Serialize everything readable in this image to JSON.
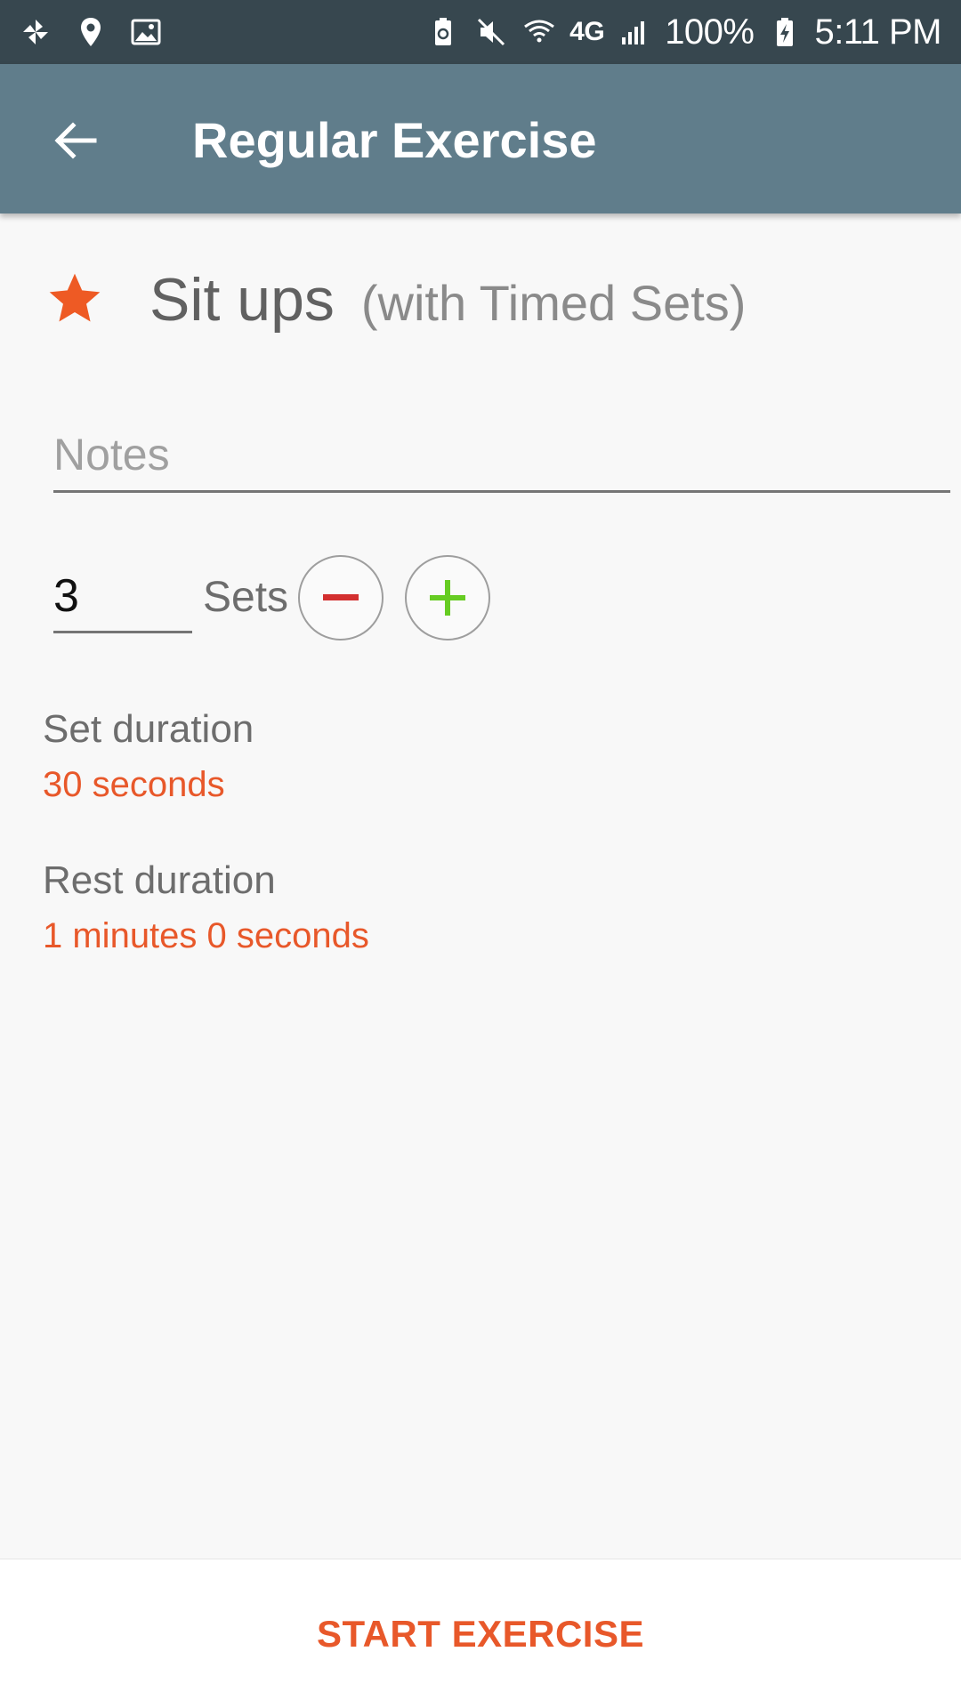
{
  "status_bar": {
    "battery_percent": "100%",
    "time": "5:11 PM",
    "network": "4G",
    "icons_left": [
      "pinwheel-icon",
      "location-pin-icon",
      "image-icon"
    ],
    "icons_right": [
      "battery-saver-icon",
      "mute-icon",
      "wifi-icon",
      "4g-lte-icon",
      "signal-icon",
      "battery-charging-icon"
    ]
  },
  "app_bar": {
    "title": "Regular Exercise",
    "back_icon": "arrow-back-icon"
  },
  "exercise": {
    "name": "Sit ups",
    "subtitle": "(with Timed Sets)",
    "favorite_icon": "star-icon",
    "accent_color": "#e8582a"
  },
  "notes": {
    "placeholder": "Notes",
    "value": ""
  },
  "sets": {
    "value": "3",
    "label": "Sets"
  },
  "set_duration": {
    "label": "Set duration",
    "value": "30 seconds"
  },
  "rest_duration": {
    "label": "Rest duration",
    "value": "1 minutes 0 seconds"
  },
  "actions": {
    "start_label": "START EXERCISE"
  },
  "colors": {
    "status_bar": "#37474f",
    "app_bar": "#607d8b",
    "accent": "#e8582a",
    "minus": "#d32f2f",
    "plus": "#66cc22"
  }
}
